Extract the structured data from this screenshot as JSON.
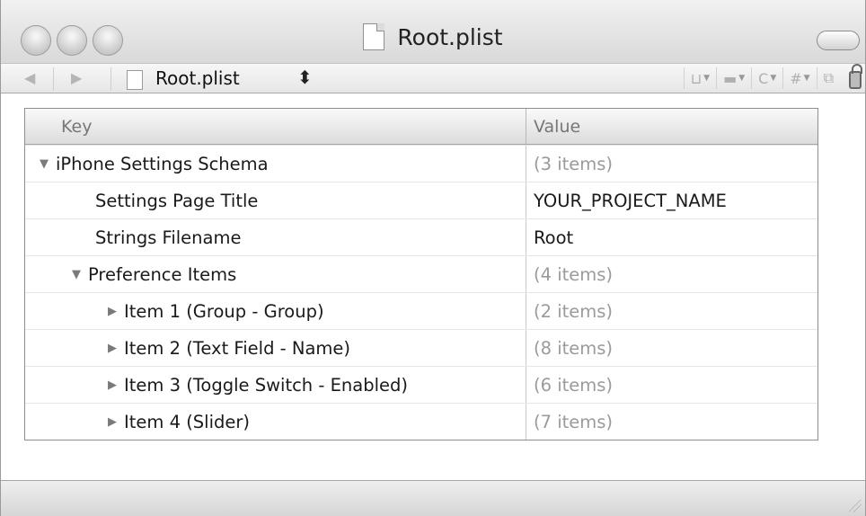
{
  "window": {
    "title": "Root.plist"
  },
  "navbar": {
    "file_name": "Root.plist",
    "updown_glyph": "⬍",
    "back_glyph": "◀",
    "forward_glyph": "▶",
    "tools": [
      {
        "icon": "bookmark-icon",
        "label": "⊔"
      },
      {
        "icon": "breakpoint-icon",
        "label": "▬"
      },
      {
        "icon": "class-icon",
        "label": "C"
      },
      {
        "icon": "include-icon",
        "label": "#"
      },
      {
        "icon": "counterpart-icon",
        "label": "⧉"
      }
    ]
  },
  "table": {
    "headers": {
      "key": "Key",
      "value": "Value"
    },
    "rows": [
      {
        "key": "iPhone Settings Schema",
        "value": "(3 items)",
        "level": 0,
        "disclosure": "▼",
        "muted": true
      },
      {
        "key": "Settings Page Title",
        "value": "YOUR_PROJECT_NAME",
        "level": 1,
        "disclosure": "",
        "muted": false
      },
      {
        "key": "Strings Filename",
        "value": "Root",
        "level": 1,
        "disclosure": "",
        "muted": false
      },
      {
        "key": "Preference Items",
        "value": "(4 items)",
        "level": 1,
        "disclosure": "▼",
        "muted": true
      },
      {
        "key": "Item 1 (Group - Group)",
        "value": "(2 items)",
        "level": 2,
        "disclosure": "▶",
        "muted": true
      },
      {
        "key": "Item 2 (Text Field - Name)",
        "value": "(8 items)",
        "level": 2,
        "disclosure": "▶",
        "muted": true
      },
      {
        "key": "Item 3 (Toggle Switch - Enabled)",
        "value": "(6 items)",
        "level": 2,
        "disclosure": "▶",
        "muted": true
      },
      {
        "key": "Item 4 (Slider)",
        "value": "(7 items)",
        "level": 2,
        "disclosure": "▶",
        "muted": true
      }
    ]
  }
}
